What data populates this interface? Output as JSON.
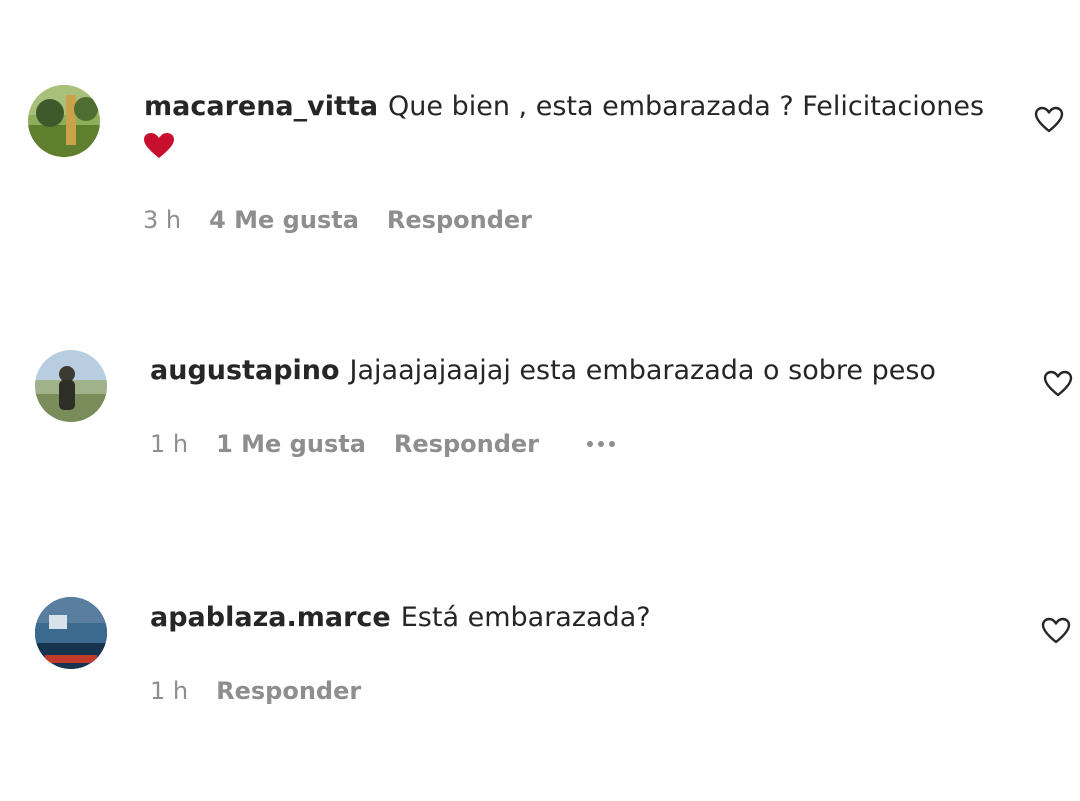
{
  "comments": [
    {
      "username": "macarena_vitta",
      "text": "Que bien , esta embarazada ? Felicitaciones",
      "emoji": "red-heart",
      "time": "3 h",
      "likes": "4 Me gusta",
      "reply": "Responder",
      "avatar_colors": [
        "#6b8c3a",
        "#c9a24a",
        "#3e5a2a"
      ]
    },
    {
      "username": "augustapino",
      "text": "Jajaajajaajaj esta embarazada o sobre peso",
      "time": "1 h",
      "likes": "1 Me gusta",
      "reply": "Responder",
      "avatar_colors": [
        "#b9cde0",
        "#3b3b32",
        "#7a8c5a"
      ]
    },
    {
      "username": "apablaza.marce",
      "text": "Está embarazada?",
      "time": "1 h",
      "reply": "Responder",
      "avatar_colors": [
        "#1e4a6e",
        "#5a7ea0",
        "#c23a2a"
      ]
    }
  ],
  "colors": {
    "primary_text": "#262626",
    "secondary_text": "#8e8e8e",
    "emoji_heart": "#c8102e"
  }
}
